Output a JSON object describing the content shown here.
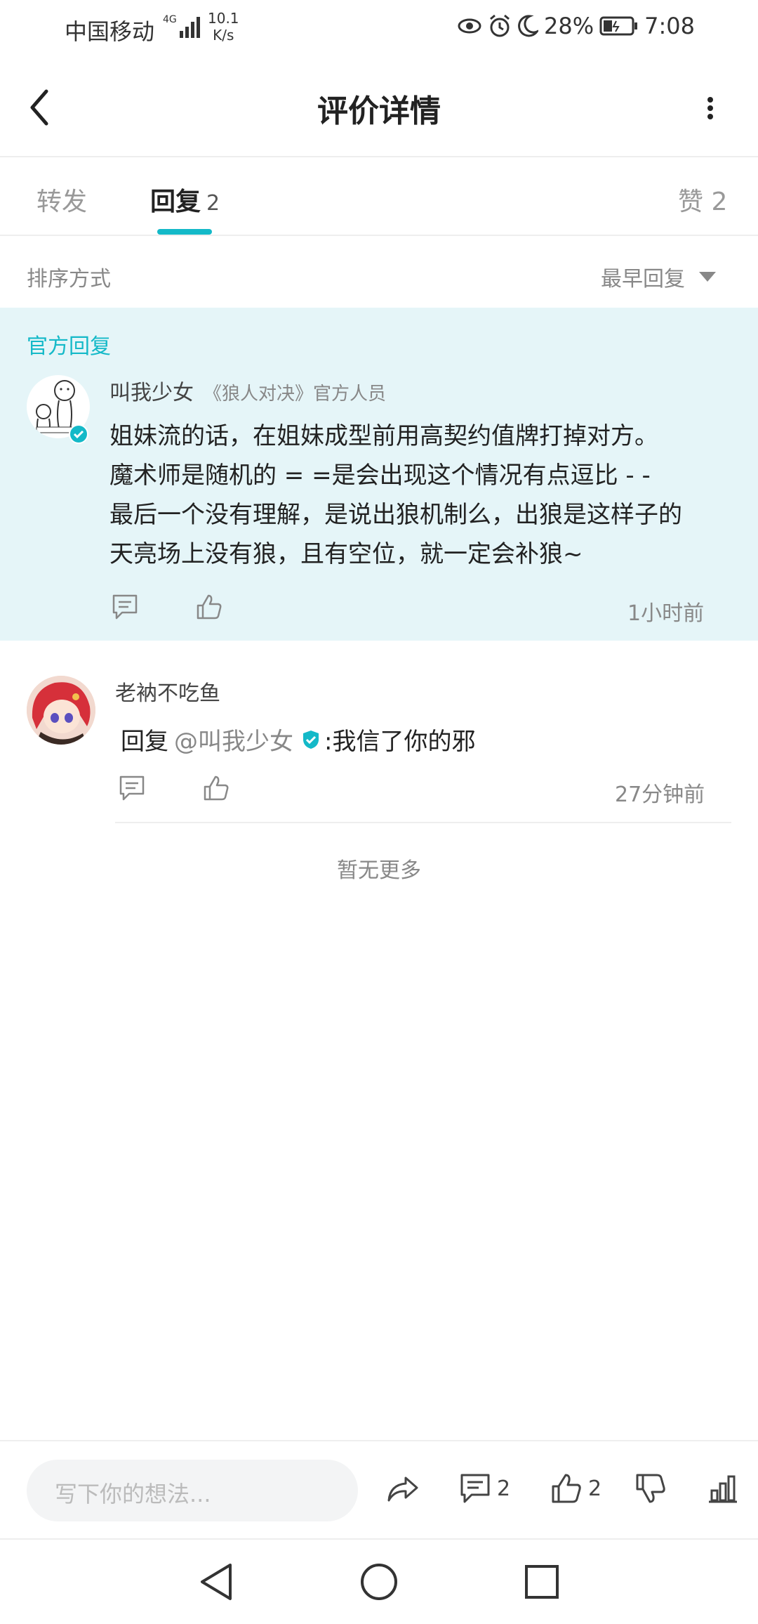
{
  "status_bar": {
    "carrier": "中国移动",
    "network": "4G",
    "speed_value": "10.1",
    "speed_unit": "K/s",
    "battery": "28%",
    "time": "7:08"
  },
  "header": {
    "title": "评价详情"
  },
  "tabs": {
    "forward": "转发",
    "reply": "回复",
    "reply_count": "2",
    "like_label": "赞 2"
  },
  "sort": {
    "label": "排序方式",
    "value": "最早回复"
  },
  "official_reply": {
    "section_label": "官方回复",
    "author": "叫我少女",
    "author_tag": "《狼人对决》官方人员",
    "lines": [
      "姐妹流的话，在姐妹成型前用高契约值牌打掉对方。",
      "魔术师是随机的 = =是会出现这个情况有点逗比 - -",
      "最后一个没有理解，是说出狼机制么，出狼是这样子的",
      "天亮场上没有狼，且有空位，就一定会补狼~"
    ],
    "time": "1小时前"
  },
  "reply": {
    "author": "老衲不吃鱼",
    "prefix": "回复",
    "mention": "@叫我少女",
    "text": ":我信了你的邪",
    "time": "27分钟前"
  },
  "no_more": "暂无更多",
  "bottom_bar": {
    "input_placeholder": "写下你的想法...",
    "comment_count": "2",
    "like_count": "2"
  },
  "colors": {
    "accent": "#14b9c8",
    "official_bg": "#e5f5f8"
  }
}
